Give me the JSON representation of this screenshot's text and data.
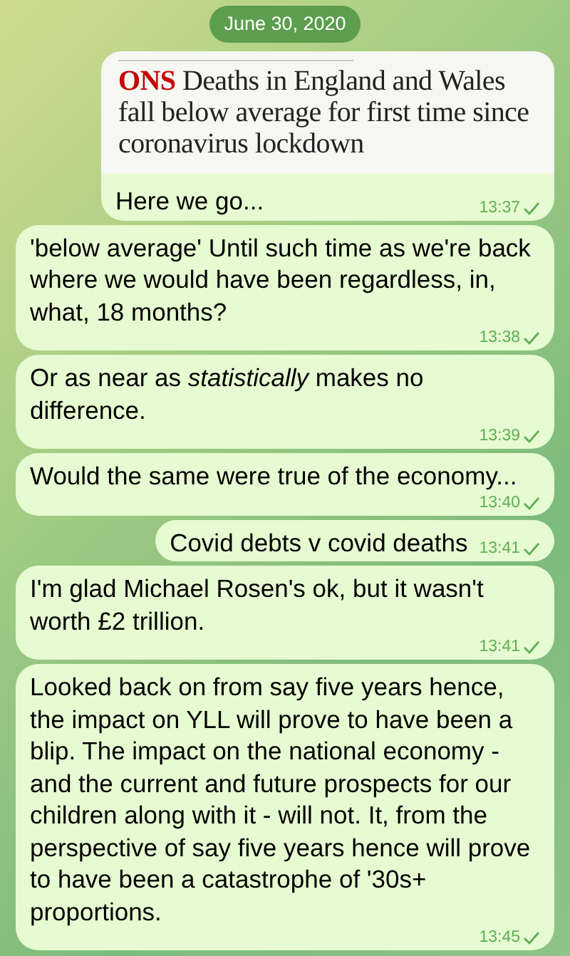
{
  "date_label": "June 30, 2020",
  "messages": [
    {
      "kind": "link_preview",
      "preview": {
        "kicker": "ONS",
        "headline": "Deaths in England and Wales fall below average for first time since coronavirus lockdown"
      },
      "text": "Here we go...",
      "time": "13:37",
      "read": false
    },
    {
      "kind": "text",
      "text": "'below average' Until such time as we're back where we would have been regardless, in, what, 18 months?",
      "time": "13:38",
      "read": false
    },
    {
      "kind": "text",
      "text": "Or as near as *statistically* makes no difference.",
      "time": "13:39",
      "read": false
    },
    {
      "kind": "text",
      "text": "Would the same were true of the economy...",
      "time": "13:40",
      "read": false
    },
    {
      "kind": "text",
      "text": "Covid debts v covid deaths",
      "time": "13:41",
      "read": false
    },
    {
      "kind": "text",
      "text": "I'm glad Michael Rosen's ok, but it wasn't worth £2 trillion.",
      "time": "13:41",
      "read": false
    },
    {
      "kind": "text",
      "text": "Looked back on from say five years hence, the impact on YLL will prove to have been a blip. The impact on the national economy - and the current and future prospects for our children along with it - will not. It, from the perspective of say five years hence will prove to have been a catastrophe of '30s+ proportions.",
      "time": "13:45",
      "read": false
    }
  ]
}
